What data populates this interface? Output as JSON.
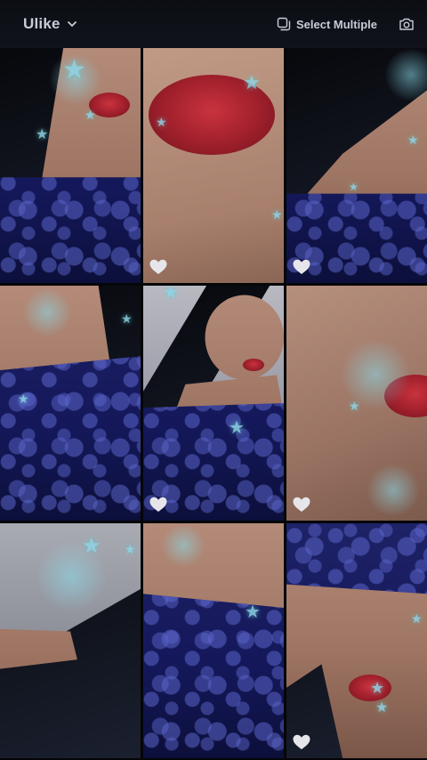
{
  "header": {
    "album_title": "Ulike",
    "select_multiple_label": "Select Multiple"
  },
  "icons": {
    "album_dropdown": "chevron-down-icon",
    "select_multiple": "select-multiple-icon",
    "camera": "camera-icon",
    "favorite": "heart-icon"
  },
  "colors": {
    "background": "#0e0f14",
    "header_text": "#c9ccd6",
    "heart": "#e6e6ea",
    "sparkle": "#8fd4e6"
  },
  "grid": {
    "columns": 3,
    "rows_visible": 3,
    "photos": [
      {
        "id": 1,
        "subject": "face-lips-hair-lace-top",
        "favorite_icon": false
      },
      {
        "id": 2,
        "subject": "lips-closeup",
        "favorite_icon": true
      },
      {
        "id": 3,
        "subject": "neck-hair-lace-top",
        "favorite_icon": true
      },
      {
        "id": 4,
        "subject": "chest-lace-top",
        "favorite_icon": false
      },
      {
        "id": 5,
        "subject": "portrait-lace-top",
        "favorite_icon": true
      },
      {
        "id": 6,
        "subject": "lips-side-closeup",
        "favorite_icon": true
      },
      {
        "id": 7,
        "subject": "hand-in-hair",
        "favorite_icon": false
      },
      {
        "id": 8,
        "subject": "neck-lace-top",
        "favorite_icon": false
      },
      {
        "id": 9,
        "subject": "upside-down-lips-lace",
        "favorite_icon": true
      }
    ]
  }
}
